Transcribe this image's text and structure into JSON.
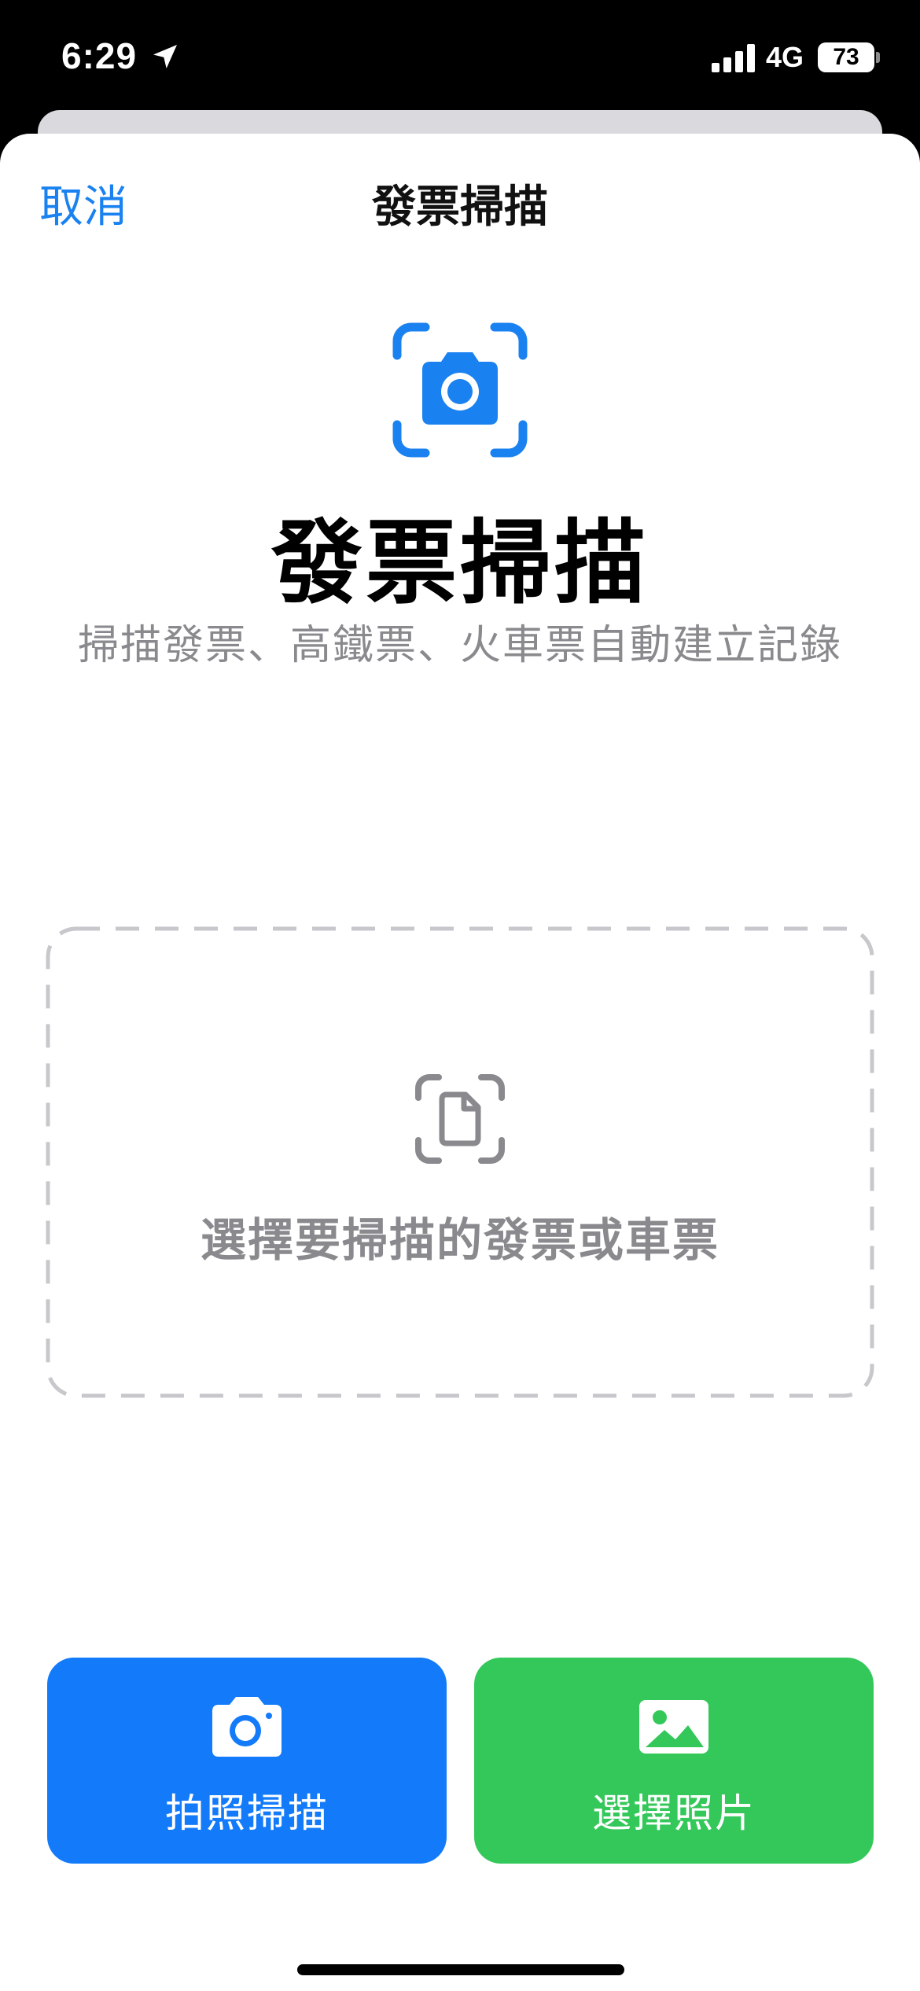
{
  "status_bar": {
    "time": "6:29",
    "network": "4G",
    "battery": "73",
    "icons": [
      "location-arrow-icon",
      "signal-icon",
      "battery-icon"
    ]
  },
  "nav": {
    "cancel_label": "取消",
    "title": "發票掃描"
  },
  "hero": {
    "icon": "camera-scan-icon",
    "title": "發票掃描",
    "subtitle": "掃描發票、高鐵票、火車票自動建立記錄"
  },
  "drop_zone": {
    "icon": "document-scan-icon",
    "label": "選擇要掃描的發票或車票"
  },
  "actions": {
    "camera_scan": {
      "label": "拍照掃描",
      "icon": "camera-icon",
      "color": "#137bfa"
    },
    "choose_photo": {
      "label": "選擇照片",
      "icon": "photo-icon",
      "color": "#34c85a"
    }
  },
  "colors": {
    "accent_blue": "#1a82f0",
    "secondary_text": "#8a8a8e",
    "dash_border": "#c7c7cc"
  }
}
